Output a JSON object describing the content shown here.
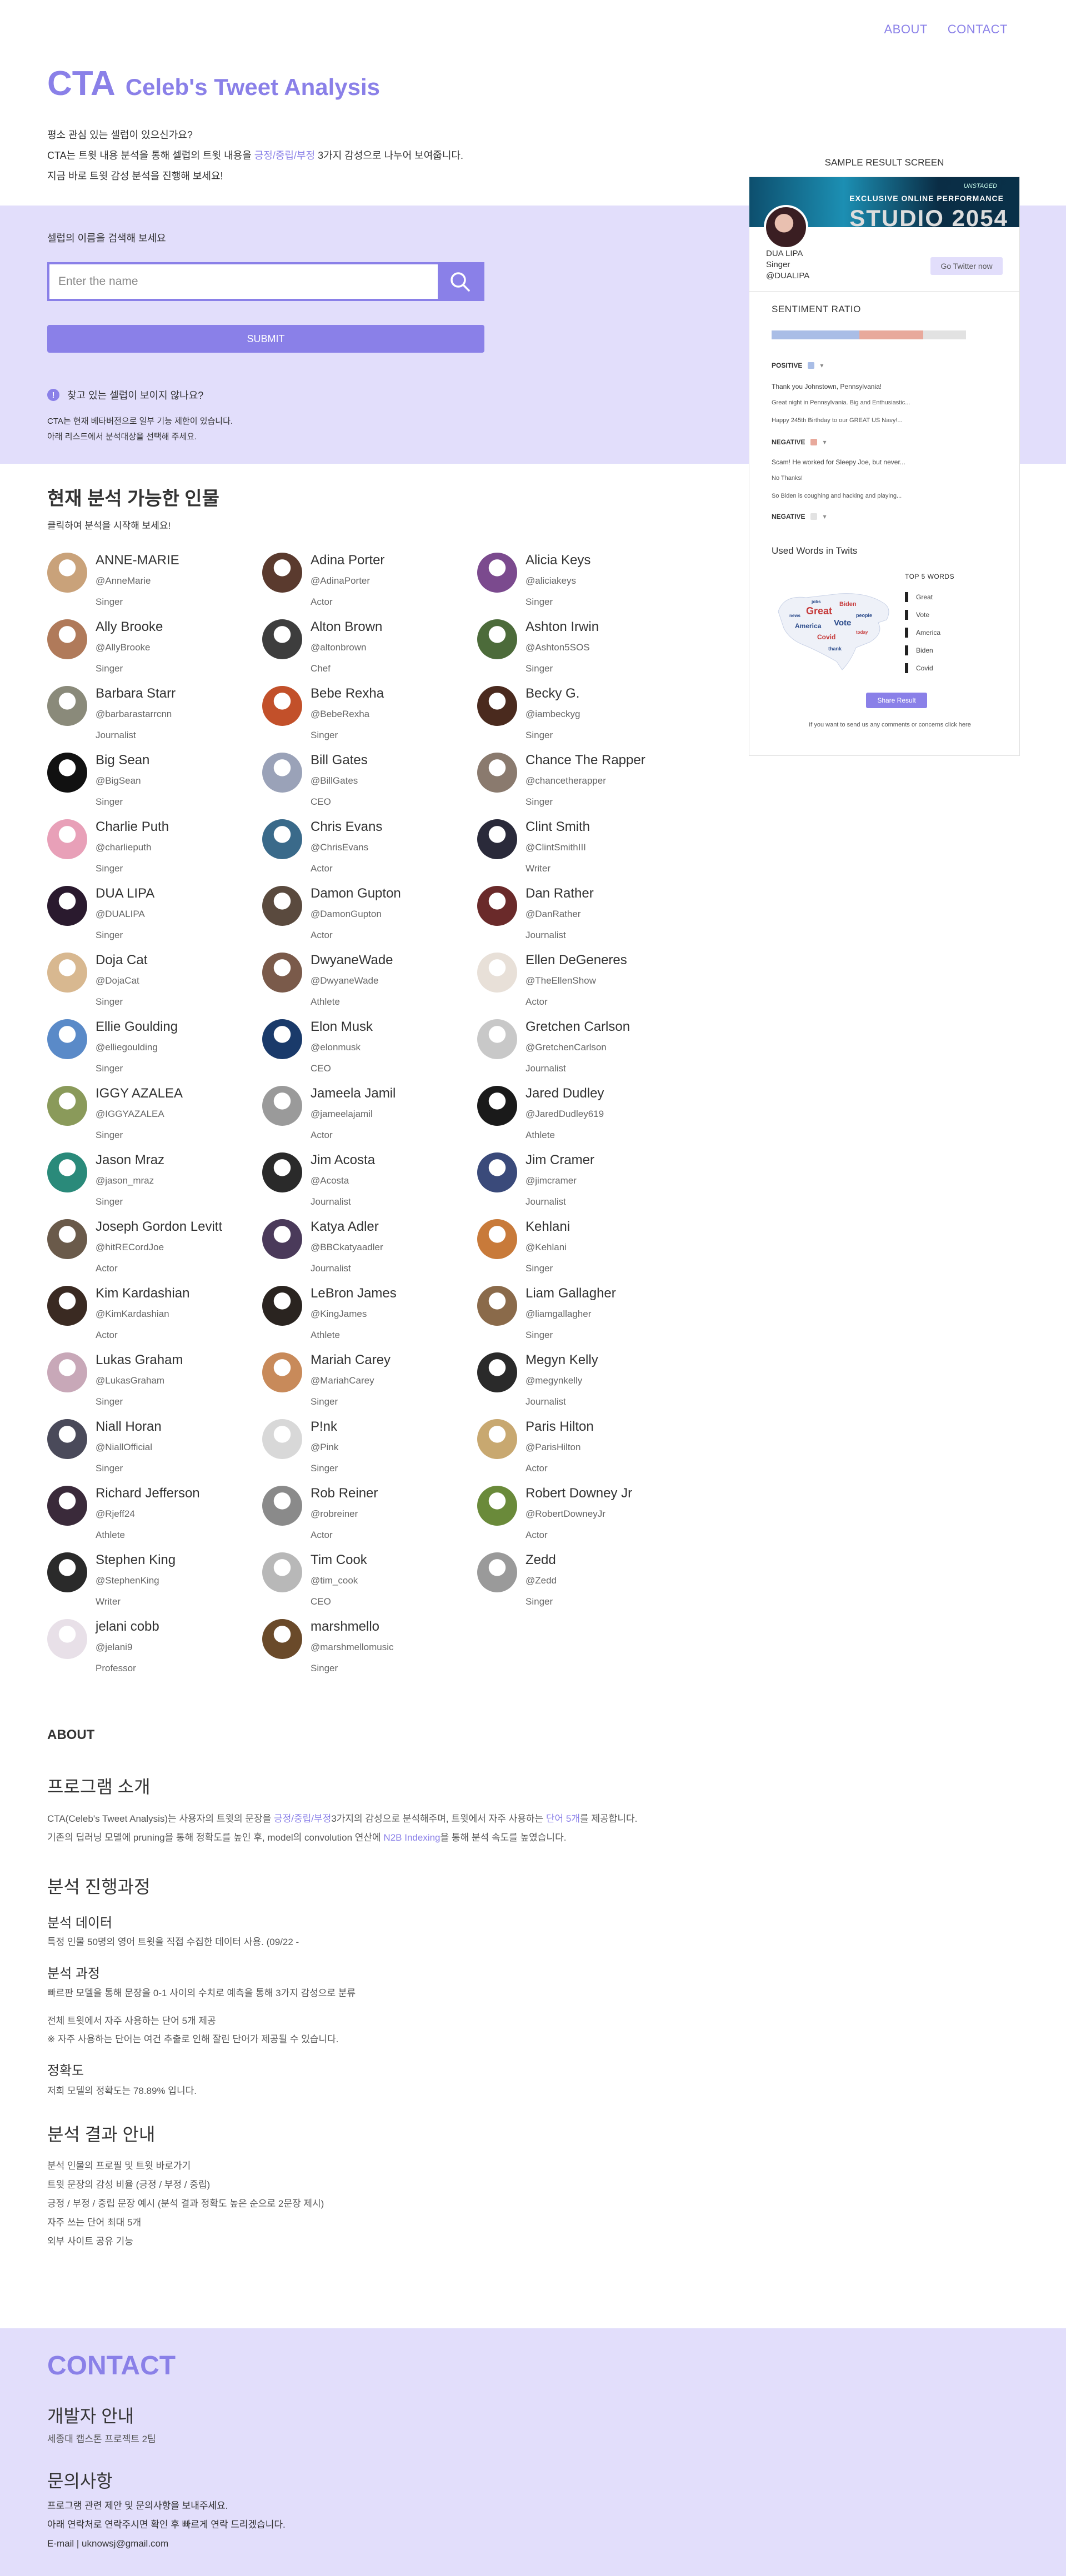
{
  "nav": {
    "about": "ABOUT",
    "contact": "CONTACT"
  },
  "hero": {
    "abbr": "CTA",
    "full": "Celeb's Tweet Analysis",
    "line1": "평소 관심 있는 셀럽이 있으신가요?",
    "line2_pre": "CTA는 트윗 내용 분석을 통해 셀럽의 트윗 내용을 ",
    "line2_accent": "긍정/중립/부정",
    "line2_post": " 3가지 감성으로 나누어 보여줍니다.",
    "line3": "지금 바로 트윗 감성 분석을 진행해 보세요!"
  },
  "search": {
    "label": "셀럽의 이름을 검색해 보세요",
    "placeholder": "Enter the name",
    "value": "",
    "submit": "SUBMIT",
    "notice_q": "찾고 있는 셀럽이 보이지 않나요?",
    "notice_1": "CTA는 현재 베타버전으로 일부 기능 제한이 있습니다.",
    "notice_2": "아래 리스트에서 분석대상을 선택해 주세요."
  },
  "sample": {
    "title": "SAMPLE RESULT SCREEN",
    "banner_small": "UNSTAGED",
    "banner_mid": "EXCLUSIVE ONLINE PERFORMANCE",
    "banner_big": "STUDIO 2054",
    "name": "DUA LIPA",
    "role": "Singer",
    "handle": "@DUALIPA",
    "twitter_btn": "Go Twitter now",
    "ratio_label": "SENTIMENT RATIO",
    "ratio": {
      "positive": 0.45,
      "negative": 0.33,
      "neutral": 0.22
    },
    "colors": {
      "positive": "#a9bde6",
      "negative": "#e8a99c",
      "neutral": "#e2e2e2"
    },
    "positive_label": "POSITIVE",
    "positive_tweet_1": "Thank you Johnstown, Pennsylvania!",
    "positive_tweet_2": "Great night in Pennsylvania. Big and Enthusiastic...",
    "positive_tweet_3": "Happy 245th Birthday to our GREAT US Navy!...",
    "negative_label": "NEGATIVE",
    "negative_tweet_1": "Scam! He worked for Sleepy Joe, but never...",
    "negative_tweet_2": "No Thanks!",
    "negative_tweet_3": "So Biden is coughing and hacking and playing...",
    "negative_label_2": "NEGATIVE",
    "words_label": "Used Words in Twits",
    "top5_title": "TOP 5 WORDS",
    "top5": [
      "Great",
      "Vote",
      "America",
      "Biden",
      "Covid"
    ],
    "share": "Share Result",
    "share_note": "If you want to send us any comments or concerns click here"
  },
  "people_section": {
    "title": "현재 분석 가능한 인물",
    "subtitle": "클릭하여 분석을 시작해 보세요!"
  },
  "people": [
    {
      "name": "ANNE-MARIE",
      "handle": "@AnneMarie",
      "role": "Singer",
      "color": "#c9a27a"
    },
    {
      "name": "Adina Porter",
      "handle": "@AdinaPorter",
      "role": "Actor",
      "color": "#5a3a2e"
    },
    {
      "name": "Alicia Keys",
      "handle": "@aliciakeys",
      "role": "Singer",
      "color": "#7b4a8e"
    },
    {
      "name": "Ally Brooke",
      "handle": "@AllyBrooke",
      "role": "Singer",
      "color": "#b07a5a"
    },
    {
      "name": "Alton Brown",
      "handle": "@altonbrown",
      "role": "Chef",
      "color": "#3d3d3d"
    },
    {
      "name": "Ashton Irwin",
      "handle": "@Ashton5SOS",
      "role": "Singer",
      "color": "#4c6b3a"
    },
    {
      "name": "Barbara Starr",
      "handle": "@barbarastarrcnn",
      "role": "Journalist",
      "color": "#8a8a7a"
    },
    {
      "name": "Bebe Rexha",
      "handle": "@BebeRexha",
      "role": "Singer",
      "color": "#c2502a"
    },
    {
      "name": "Becky G.",
      "handle": "@iambeckyg",
      "role": "Singer",
      "color": "#4a2a1e"
    },
    {
      "name": "Big Sean",
      "handle": "@BigSean",
      "role": "Singer",
      "color": "#111111"
    },
    {
      "name": "Bill Gates",
      "handle": "@BillGates",
      "role": "CEO",
      "color": "#9aa2b8"
    },
    {
      "name": "Chance The Rapper",
      "handle": "@chancetherapper",
      "role": "Singer",
      "color": "#8a7a6e"
    },
    {
      "name": "Charlie Puth",
      "handle": "@charlieputh",
      "role": "Singer",
      "color": "#e8a0b8"
    },
    {
      "name": "Chris Evans",
      "handle": "@ChrisEvans",
      "role": "Actor",
      "color": "#3a6a8a"
    },
    {
      "name": "Clint Smith",
      "handle": "@ClintSmithIII",
      "role": "Writer",
      "color": "#2a2a3a"
    },
    {
      "name": "DUA LIPA",
      "handle": "@DUALIPA",
      "role": "Singer",
      "color": "#2a1a2e"
    },
    {
      "name": "Damon Gupton",
      "handle": "@DamonGupton",
      "role": "Actor",
      "color": "#5a4a3e"
    },
    {
      "name": "Dan Rather",
      "handle": "@DanRather",
      "role": "Journalist",
      "color": "#6a2a2a"
    },
    {
      "name": "Doja Cat",
      "handle": "@DojaCat",
      "role": "Singer",
      "color": "#d8b890"
    },
    {
      "name": "DwyaneWade",
      "handle": "@DwyaneWade",
      "role": "Athlete",
      "color": "#7a5a4a"
    },
    {
      "name": "Ellen DeGeneres",
      "handle": "@TheEllenShow",
      "role": "Actor",
      "color": "#e8e0d8"
    },
    {
      "name": "Ellie Goulding",
      "handle": "@elliegoulding",
      "role": "Singer",
      "color": "#5a8ac8"
    },
    {
      "name": "Elon Musk",
      "handle": "@elonmusk",
      "role": "CEO",
      "color": "#1a3a6a"
    },
    {
      "name": "Gretchen Carlson",
      "handle": "@GretchenCarlson",
      "role": "Journalist",
      "color": "#c8c8c8"
    },
    {
      "name": "IGGY AZALEA",
      "handle": "@IGGYAZALEA",
      "role": "Singer",
      "color": "#8a9a5a"
    },
    {
      "name": "Jameela Jamil",
      "handle": "@jameelajamil",
      "role": "Actor",
      "color": "#9a9a9a"
    },
    {
      "name": "Jared Dudley",
      "handle": "@JaredDudley619",
      "role": "Athlete",
      "color": "#1a1a1a"
    },
    {
      "name": "Jason Mraz",
      "handle": "@jason_mraz",
      "role": "Singer",
      "color": "#2a8a7a"
    },
    {
      "name": "Jim Acosta",
      "handle": "@Acosta",
      "role": "Journalist",
      "color": "#2a2a2a"
    },
    {
      "name": "Jim Cramer",
      "handle": "@jimcramer",
      "role": "Journalist",
      "color": "#3a4a7a"
    },
    {
      "name": "Joseph Gordon Levitt",
      "handle": "@hitRECordJoe",
      "role": "Actor",
      "color": "#6a5a4a"
    },
    {
      "name": "Katya Adler",
      "handle": "@BBCkatyaadler",
      "role": "Journalist",
      "color": "#4a3a5a"
    },
    {
      "name": "Kehlani",
      "handle": "@Kehlani",
      "role": "Singer",
      "color": "#c87a3a"
    },
    {
      "name": "Kim Kardashian",
      "handle": "@KimKardashian",
      "role": "Actor",
      "color": "#3a2a22"
    },
    {
      "name": "LeBron James",
      "handle": "@KingJames",
      "role": "Athlete",
      "color": "#2a2420"
    },
    {
      "name": "Liam Gallagher",
      "handle": "@liamgallagher",
      "role": "Singer",
      "color": "#8a6a4a"
    },
    {
      "name": "Lukas Graham",
      "handle": "@LukasGraham",
      "role": "Singer",
      "color": "#c8a8b8"
    },
    {
      "name": "Mariah Carey",
      "handle": "@MariahCarey",
      "role": "Singer",
      "color": "#c88a5a"
    },
    {
      "name": "Megyn Kelly",
      "handle": "@megynkelly",
      "role": "Journalist",
      "color": "#2a2a2a"
    },
    {
      "name": "Niall Horan",
      "handle": "@NiallOfficial",
      "role": "Singer",
      "color": "#4a4a5a"
    },
    {
      "name": "P!nk",
      "handle": "@Pink",
      "role": "Singer",
      "color": "#d8d8d8"
    },
    {
      "name": "Paris Hilton",
      "handle": "@ParisHilton",
      "role": "Actor",
      "color": "#c8a870"
    },
    {
      "name": "Richard Jefferson",
      "handle": "@Rjeff24",
      "role": "Athlete",
      "color": "#3a2a3a"
    },
    {
      "name": "Rob Reiner",
      "handle": "@robreiner",
      "role": "Actor",
      "color": "#8a8a8a"
    },
    {
      "name": "Robert Downey Jr",
      "handle": "@RobertDowneyJr",
      "role": "Actor",
      "color": "#6a8a3a"
    },
    {
      "name": "Stephen King",
      "handle": "@StephenKing",
      "role": "Writer",
      "color": "#2a2a2a"
    },
    {
      "name": "Tim Cook",
      "handle": "@tim_cook",
      "role": "CEO",
      "color": "#b8b8b8"
    },
    {
      "name": "Zedd",
      "handle": "@Zedd",
      "role": "Singer",
      "color": "#9a9a9a"
    },
    {
      "name": "jelani cobb",
      "handle": "@jelani9",
      "role": "Professor",
      "color": "#e8e0e8"
    },
    {
      "name": "marshmello",
      "handle": "@marshmellomusic",
      "role": "Singer",
      "color": "#6a4a2a"
    }
  ],
  "about": {
    "title": "ABOUT",
    "program_title": "프로그램 소개",
    "program_1_pre": "CTA(Celeb's Tweet Analysis)는 사용자의 트윗의 문장을 ",
    "program_1_accent": "긍정/중립/부정",
    "program_1_mid": "3가지의 감성으로 분석해주며, 트윗에서 자주 사용하는 ",
    "program_1_accent2": "단어 5개",
    "program_1_post": "를 제공합니다.",
    "program_2_pre": "기존의 딥러닝 모델에 pruning을 통해 정확도를 높인 후, model의 convolution 연산에 ",
    "program_2_accent": "N2B Indexing",
    "program_2_post": "을 통해 분석 속도를 높였습니다.",
    "process_title": "분석 진행과정",
    "data_title": "분석 데이터",
    "data_text": "특정 인물 50명의 영어 트윗을 직접 수집한 데이터 사용. (09/22 -",
    "procedure_title": "분석 과정",
    "procedure_1": "빠르판 모델을 통해 문장을 0-1 사이의 수치로 예측을 통해 3가지 감성으로 분류",
    "procedure_2": "전체 트윗에서 자주 사용하는 단어 5개 제공",
    "procedure_3": "※ 자주 사용하는 단어는 여건 추출로 인해 잘린 단어가 제공될 수 있습니다.",
    "accuracy_title": "정확도",
    "accuracy_text": "저희 모델의 정확도는 78.89% 입니다.",
    "guide_title": "분석 결과 안내",
    "guide_1": "분석 인물의 프로필 및 트윗 바로가기",
    "guide_2": "트윗 문장의 감성 비율 (긍정 / 부정 / 중립)",
    "guide_3": "긍정 / 부정 / 중립 문장 예시 (분석 결과 정확도 높은 순으로 2문장 제시)",
    "guide_4": "자주 쓰는 단어 최대 5개",
    "guide_5": "외부 사이트 공유 기능"
  },
  "contact": {
    "title": "CONTACT",
    "dev_title": "개발자 안내",
    "dev_text": "세종대 캡스톤 프로젝트 2팀",
    "inquiry_title": "문의사항",
    "inquiry_1": "프로그램 관련 제안 및 문의사항을 보내주세요.",
    "inquiry_2": "아래 연락처로 연락주시면 확인 후 빠르게 연락 드리겠습니다.",
    "email": "E-mail | uknowsj@gmail.com"
  }
}
